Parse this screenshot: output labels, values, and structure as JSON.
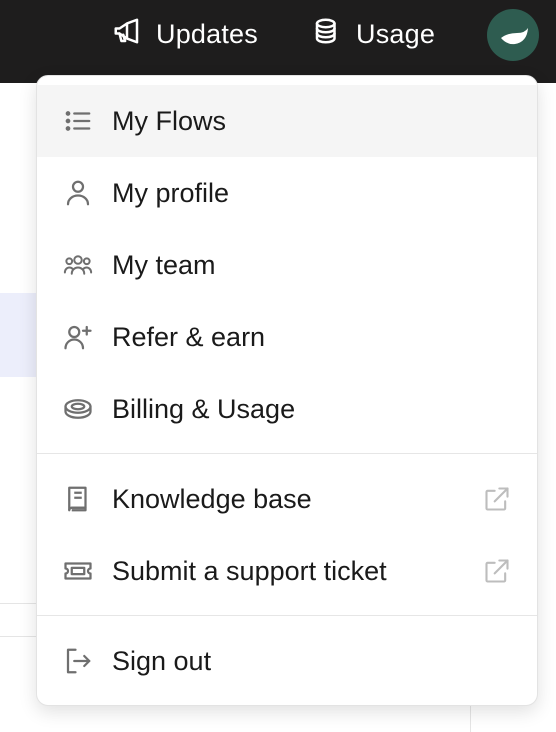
{
  "header": {
    "updates_label": "Updates",
    "usage_label": "Usage"
  },
  "menu": {
    "items": [
      {
        "label": "My Flows",
        "icon": "list-icon"
      },
      {
        "label": "My profile",
        "icon": "user-icon"
      },
      {
        "label": "My team",
        "icon": "team-icon"
      },
      {
        "label": "Refer & earn",
        "icon": "user-plus-icon"
      },
      {
        "label": "Billing & Usage",
        "icon": "coin-icon"
      },
      {
        "label": "Knowledge base",
        "icon": "book-icon"
      },
      {
        "label": "Submit a support ticket",
        "icon": "ticket-icon"
      },
      {
        "label": "Sign out",
        "icon": "sign-out-icon"
      }
    ]
  },
  "colors": {
    "topbar": "#1e1d1d",
    "avatar": "#2e5c50",
    "active_row": "#f5f5f5"
  }
}
